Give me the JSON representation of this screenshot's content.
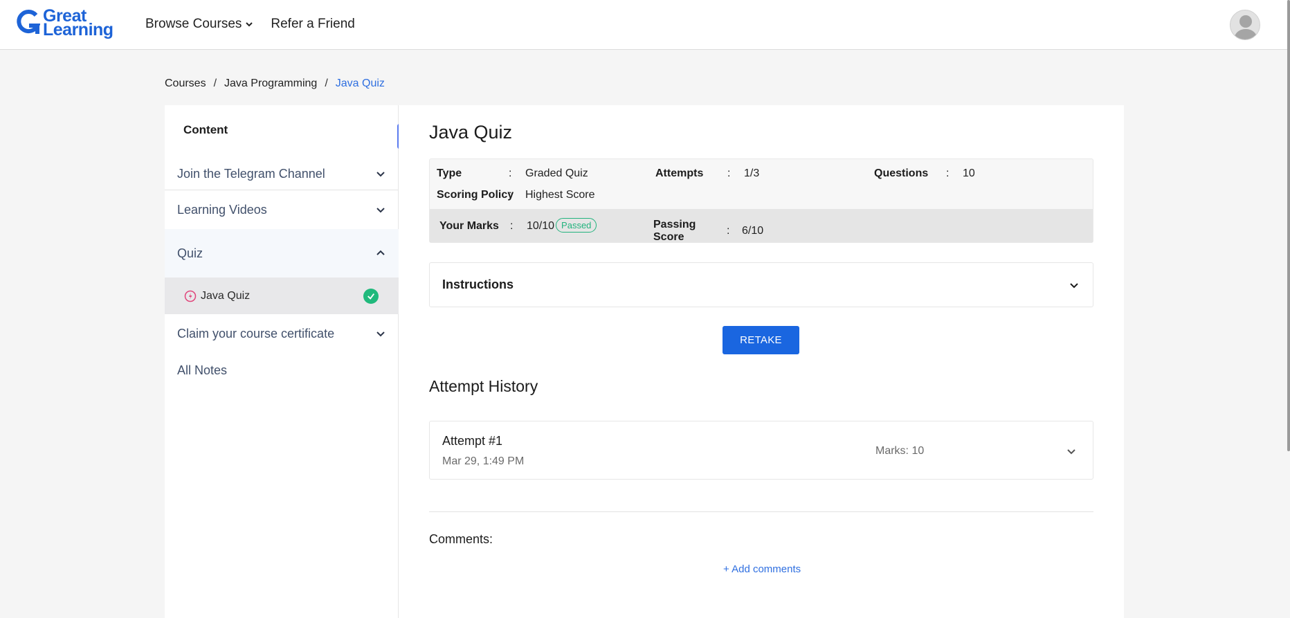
{
  "header": {
    "logo_line1": "Great",
    "logo_line2": "Learning",
    "nav": [
      {
        "label": "Browse Courses"
      },
      {
        "label": "Refer a Friend"
      }
    ]
  },
  "breadcrumb": {
    "items": [
      "Courses",
      "Java Programming",
      "Java Quiz"
    ],
    "separator": "/"
  },
  "sidebar": {
    "title": "Content",
    "items": [
      {
        "label": "Join the Telegram Channel"
      },
      {
        "label": "Learning Videos"
      },
      {
        "label": "Quiz"
      },
      {
        "label": "Claim your course certificate"
      },
      {
        "label": "All Notes"
      }
    ],
    "sub_item": {
      "label": "Java Quiz"
    },
    "collapse_glyph": "«"
  },
  "quiz": {
    "title": "Java Quiz",
    "info": {
      "type_key": "Type",
      "type_val": "Graded Quiz",
      "attempts_key": "Attempts",
      "attempts_val": "1/3",
      "questions_key": "Questions",
      "questions_val": "10",
      "policy_key": "Scoring Policy",
      "policy_val": "Highest Score",
      "colon": ":"
    },
    "marks": {
      "your_key": "Your Marks",
      "your_val": "10/10",
      "status": "Passed",
      "passing_key": "Passing Score",
      "passing_val": "6/10"
    },
    "instructions_label": "Instructions",
    "retake_label": "RETAKE",
    "history_title": "Attempt History",
    "attempts": [
      {
        "name": "Attempt #1",
        "date": "Mar 29, 1:49 PM",
        "marks": "Marks: 10"
      }
    ],
    "comments_label": "Comments:",
    "add_comments_label": "+ Add comments"
  },
  "colors": {
    "brand": "#1d63d7",
    "primary_button": "#1a66e0",
    "success": "#20b97c",
    "link": "#2f6fe0"
  },
  "icons": [
    "g-logo-icon",
    "chevron-down-icon",
    "chevron-up-icon",
    "avatar-icon",
    "quiz-icon",
    "check-circle-icon",
    "double-chevron-left-icon"
  ]
}
